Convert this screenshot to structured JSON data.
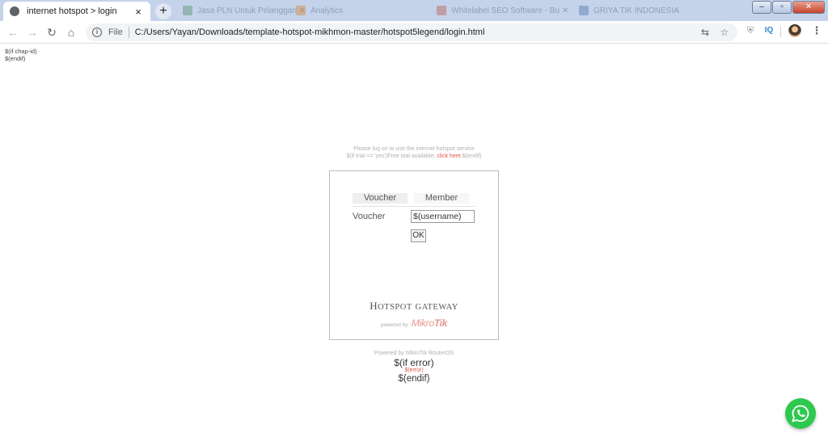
{
  "browser": {
    "active_tab": {
      "title": "internet hotspot > login",
      "close": "×"
    },
    "new_tab": "+",
    "background_tabs": [
      {
        "title": "Jasa PLN Untuk Pelanggan ✕"
      },
      {
        "title": "Analytics"
      },
      {
        "title": "Whitelabel SEO Software - Bu ✕"
      },
      {
        "title": "GRIYA TIK INDONESIA"
      }
    ],
    "window_controls": {
      "minimize": "–",
      "maximize": "▫",
      "close": "✕"
    },
    "nav": {
      "back": "←",
      "forward": "→",
      "reload": "↻",
      "home": "⌂"
    },
    "omnibox": {
      "info": "i",
      "scheme": "File",
      "url": "C:/Users/Yayan/Downloads/template-hotspot-mikhmon-master/hotspot5legend/login.html",
      "translate": "⇆",
      "bookmark": "☆"
    },
    "extensions": {
      "shield": "⛨",
      "iq": "IQ",
      "menu": "⋮"
    }
  },
  "page": {
    "chap_lines": [
      "$(if chap-id)",
      "$(endif)"
    ],
    "info_line1": "Please log on to use the internet hotspot service",
    "info_line2_prefix": "$(if trial == 'yes')Free trial available, ",
    "info_line2_link": "click here.",
    "info_line2_suffix": "$(endif)",
    "tabs": [
      "Voucher",
      "Member"
    ],
    "field_label": "Voucher",
    "username_value": "$(username)",
    "ok_label": "OK",
    "gateway_title_big1": "H",
    "gateway_title_small1": "OTSPOT",
    "gateway_title_small2": "GATEWAY",
    "powered_small": "powered by",
    "brand_logo_a": "Mikro",
    "brand_logo_b": "Tik",
    "footer_powered": "Powered by MikroTik RouterOS",
    "if_error": "$(if error)",
    "error_var": "$(error)",
    "endif": "$(endif)"
  },
  "colors": {
    "chrome_tabstrip": "#c4d3ea",
    "link_red": "#e0543f",
    "whatsapp_green": "#2fc84f"
  },
  "icons": {
    "tab_favicon": "globe-icon",
    "whatsapp": "whatsapp-icon"
  }
}
